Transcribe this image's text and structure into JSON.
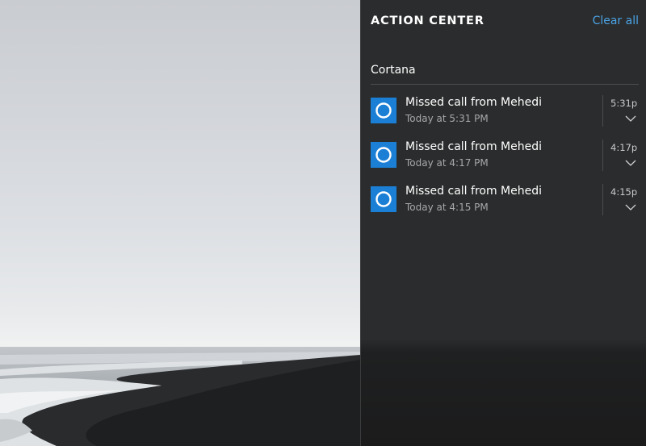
{
  "action_center": {
    "title": "ACTION CENTER",
    "clear_all": "Clear all",
    "group": "Cortana",
    "notifications": [
      {
        "title": "Missed call from Mehedi",
        "subtitle": "Today at 5:31 PM",
        "time": "5:31p",
        "icon": "cortana-circle-icon"
      },
      {
        "title": "Missed call from Mehedi",
        "subtitle": "Today at 4:17 PM",
        "time": "4:17p",
        "icon": "cortana-circle-icon"
      },
      {
        "title": "Missed call from Mehedi",
        "subtitle": "Today at 4:15 PM",
        "time": "4:15p",
        "icon": "cortana-circle-icon"
      }
    ]
  },
  "colors": {
    "accent": "#4aa3e6",
    "app_tile": "#1b7fd6",
    "panel_bg": "#2b2c2d"
  }
}
